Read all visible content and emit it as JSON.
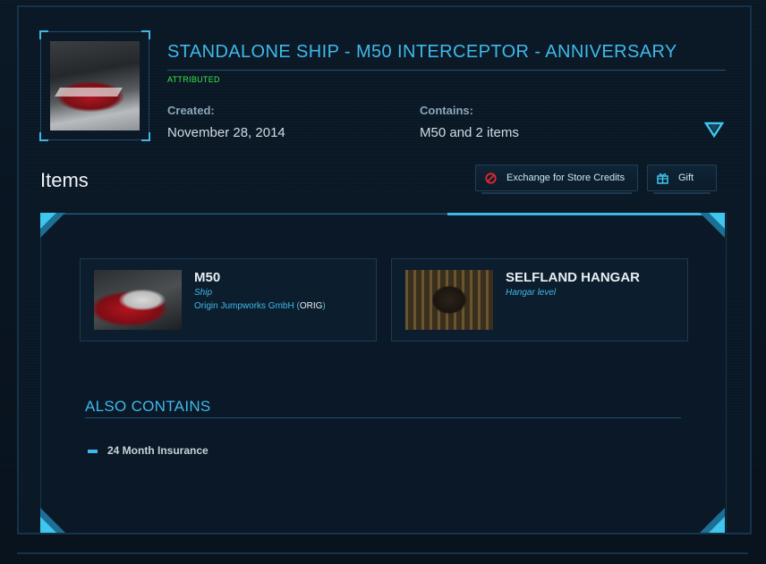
{
  "pledge": {
    "title": "STANDALONE SHIP - M50 INTERCEPTOR - ANNIVERSARY",
    "status": "ATTRIBUTED",
    "created_label": "Created:",
    "created_value": "November 28, 2014",
    "contains_label": "Contains:",
    "contains_value": "M50 and 2 items",
    "expand_icon": "chevron-down-triangle-icon"
  },
  "items_section": {
    "heading": "Items",
    "exchange_label": "Exchange for Store Credits",
    "gift_label": "Gift"
  },
  "items": [
    {
      "title": "M50",
      "type": "Ship",
      "manufacturer": "Origin Jumpworks GmbH",
      "manufacturer_code": "ORIG"
    },
    {
      "title": "SELFLAND HANGAR",
      "type": "Hangar level"
    }
  ],
  "also_contains": {
    "heading": "ALSO CONTAINS",
    "items": [
      "24 Month Insurance"
    ]
  },
  "colors": {
    "accent": "#3fb9ea",
    "status_green": "#3ce84a",
    "danger": "#e0282e"
  }
}
